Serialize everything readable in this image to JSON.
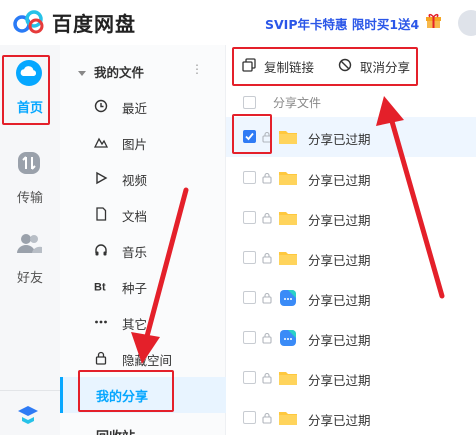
{
  "header": {
    "logo_text": "百度网盘",
    "promo_text": "SVIP年卡特惠 限时买1送4"
  },
  "rail": {
    "items": [
      {
        "label": "首页",
        "active": true
      },
      {
        "label": "传输",
        "active": false
      },
      {
        "label": "好友",
        "active": false
      }
    ]
  },
  "nav": {
    "group_label": "我的文件",
    "items": [
      {
        "label": "最近",
        "icon": "clock-icon"
      },
      {
        "label": "图片",
        "icon": "image-icon"
      },
      {
        "label": "视频",
        "icon": "video-icon"
      },
      {
        "label": "文档",
        "icon": "document-icon"
      },
      {
        "label": "音乐",
        "icon": "headphones-icon"
      },
      {
        "label": "种子",
        "icon": "bt-icon"
      },
      {
        "label": "其它",
        "icon": "more-icon"
      },
      {
        "label": "隐藏空间",
        "icon": "lock-icon"
      }
    ],
    "my_share": "我的分享",
    "recycle": "回收站"
  },
  "toolbar": {
    "copy_link": "复制链接",
    "cancel_share": "取消分享"
  },
  "table": {
    "header": "分享文件",
    "rows": [
      {
        "name": "分享已过期",
        "icon": "folder",
        "checked": true
      },
      {
        "name": "分享已过期",
        "icon": "folder",
        "checked": false
      },
      {
        "name": "分享已过期",
        "icon": "folder",
        "checked": false
      },
      {
        "name": "分享已过期",
        "icon": "folder",
        "checked": false
      },
      {
        "name": "分享已过期",
        "icon": "note",
        "checked": false
      },
      {
        "name": "分享已过期",
        "icon": "note",
        "checked": false
      },
      {
        "name": "分享已过期",
        "icon": "folder",
        "checked": false
      },
      {
        "name": "分享已过期",
        "icon": "folder",
        "checked": false
      }
    ]
  },
  "colors": {
    "accent": "#06a7ff",
    "annotation_red": "#e4202a",
    "checkbox_blue": "#2f7bf5",
    "folder_yellow": "#ffc83d"
  }
}
